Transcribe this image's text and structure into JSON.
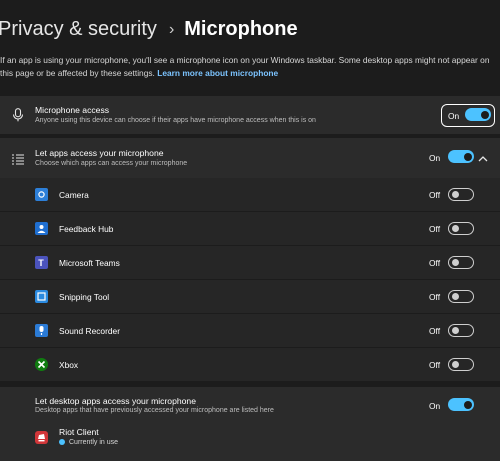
{
  "breadcrumb": {
    "parent": "Privacy & security",
    "separator": "›",
    "current": "Microphone"
  },
  "description": {
    "text": "If an app is using your microphone, you'll see a microphone icon on your Windows taskbar. Some desktop apps might not appear on this page or be affected by these settings.",
    "link": "Learn more about microphone"
  },
  "microphone_access": {
    "icon": "microphone-icon",
    "title": "Microphone access",
    "subtitle": "Anyone using this device can choose if their apps have microphone access when this is on",
    "state": "On"
  },
  "apps_access": {
    "icon": "app-list-icon",
    "title": "Let apps access your microphone",
    "subtitle": "Choose which apps can access your microphone",
    "state": "On",
    "apps": [
      {
        "name": "Camera",
        "state": "Off",
        "icon": "camera-app-icon",
        "color": "#2d7fd8"
      },
      {
        "name": "Feedback Hub",
        "state": "Off",
        "icon": "feedback-hub-icon",
        "color": "#1f6fd1"
      },
      {
        "name": "Microsoft Teams",
        "state": "Off",
        "icon": "teams-icon",
        "color": "#4b53bc"
      },
      {
        "name": "Snipping Tool",
        "state": "Off",
        "icon": "snipping-tool-icon",
        "color": "#2a8ae0"
      },
      {
        "name": "Sound Recorder",
        "state": "Off",
        "icon": "sound-recorder-icon",
        "color": "#2b7bd6"
      },
      {
        "name": "Xbox",
        "state": "Off",
        "icon": "xbox-icon",
        "color": "#107c10"
      }
    ]
  },
  "desktop_apps": {
    "title": "Let desktop apps access your microphone",
    "subtitle": "Desktop apps that have previously accessed your microphone are listed here",
    "state": "On",
    "app": {
      "name": "Riot Client",
      "status": "Currently in use",
      "icon": "riot-client-icon",
      "color": "#d13639"
    }
  },
  "colors": {
    "accent": "#4cc2ff",
    "background": "#1c1c1c",
    "card": "#2b2b2b"
  }
}
